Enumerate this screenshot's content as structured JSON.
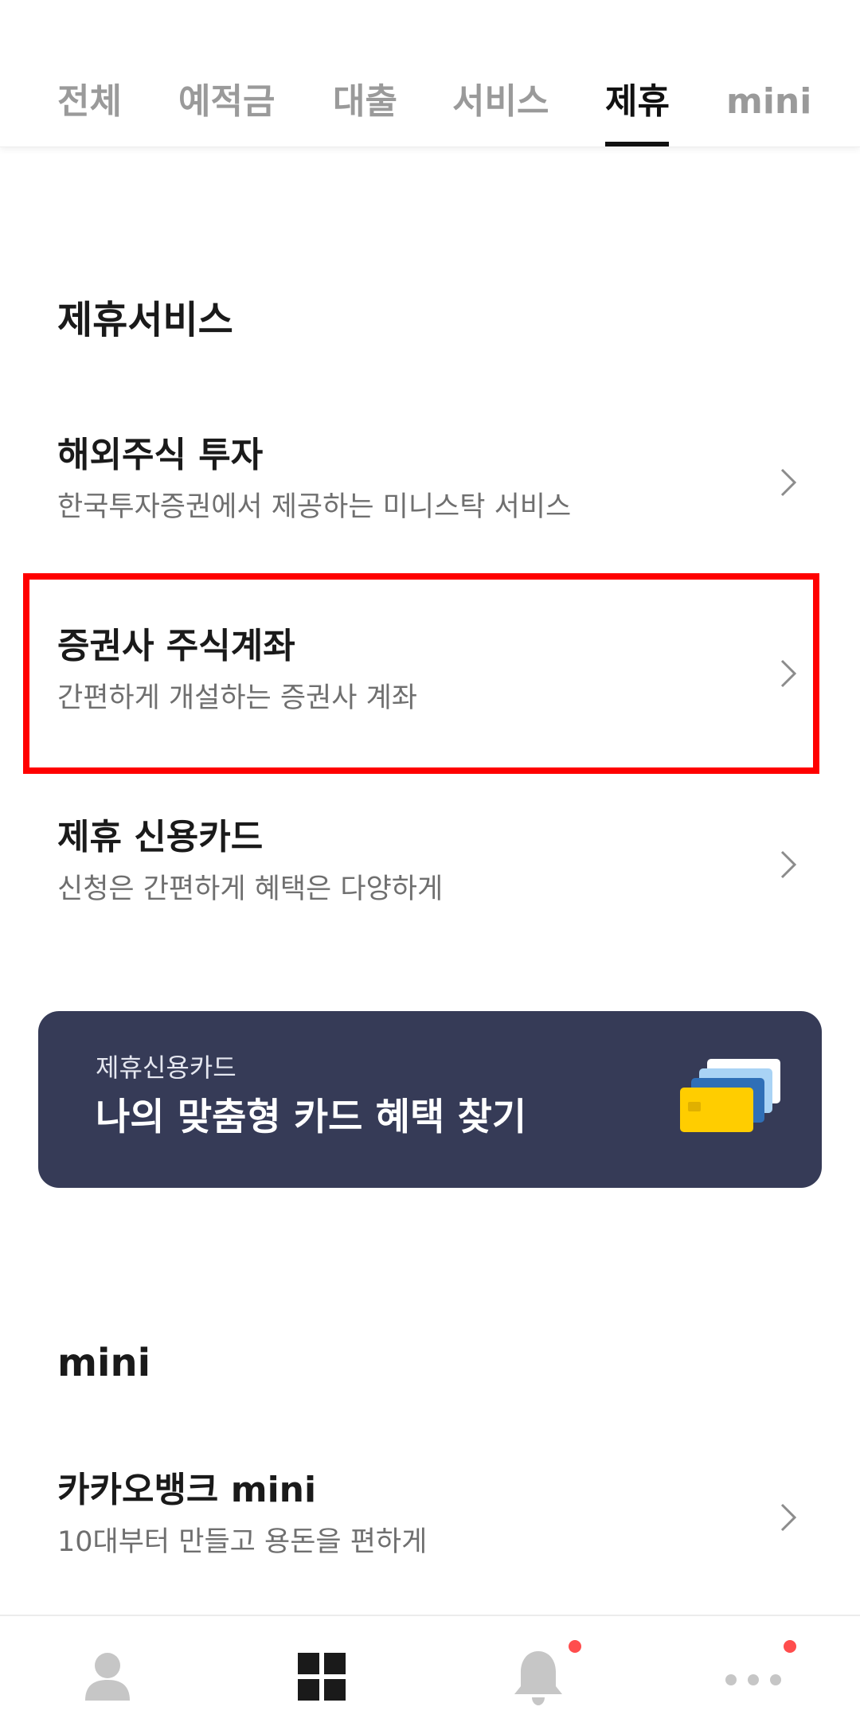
{
  "tabs": [
    {
      "label": "전체",
      "active": false
    },
    {
      "label": "예적금",
      "active": false
    },
    {
      "label": "대출",
      "active": false
    },
    {
      "label": "서비스",
      "active": false
    },
    {
      "label": "제휴",
      "active": true
    },
    {
      "label": "mini",
      "active": false
    }
  ],
  "partner_section": {
    "title": "제휴서비스",
    "items": [
      {
        "title": "해외주식 투자",
        "subtitle": "한국투자증권에서 제공하는 미니스탁 서비스"
      },
      {
        "title": "증권사 주식계좌",
        "subtitle": "간편하게 개설하는 증권사 계좌"
      },
      {
        "title": "제휴 신용카드",
        "subtitle": "신청은 간편하게 혜택은 다양하게"
      }
    ]
  },
  "banner": {
    "subtitle": "제휴신용카드",
    "title": "나의 맞춤형 카드 혜택 찾기",
    "icon": "credit-cards-icon"
  },
  "mini_section": {
    "title": "mini",
    "items": [
      {
        "title": "카카오뱅크 mini",
        "subtitle": "10대부터 만들고 용돈을 편하게"
      }
    ]
  },
  "bottom_nav": [
    {
      "icon": "person-icon",
      "active": false,
      "badge": false
    },
    {
      "icon": "grid-icon",
      "active": true,
      "badge": false
    },
    {
      "icon": "bell-icon",
      "active": false,
      "badge": true
    },
    {
      "icon": "more-icon",
      "active": false,
      "badge": true
    }
  ],
  "colors": {
    "highlight": "#ff0000",
    "banner_bg": "#363b57",
    "badge": "#ff4d4d",
    "active_tab": "#111111",
    "inactive_tab": "#9a9a9a"
  }
}
